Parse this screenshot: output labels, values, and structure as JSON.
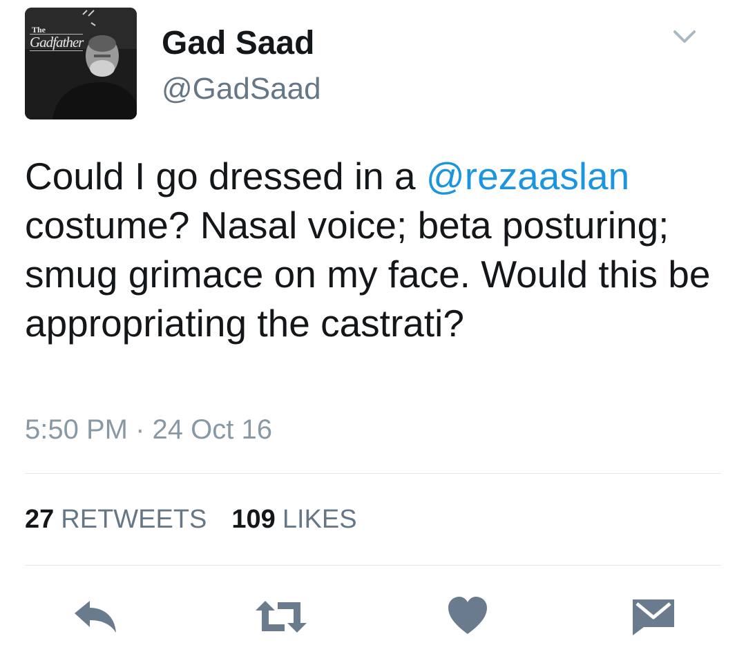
{
  "author": {
    "display_name": "Gad Saad",
    "handle": "@GadSaad",
    "avatar_title_small": "The",
    "avatar_title_main": "Gadfather"
  },
  "tweet": {
    "text_before_mention": "Could I go dressed in a ",
    "mention": "@rezaaslan",
    "text_after_mention": " costume? Nasal voice; beta posturing; smug grimace on my face. Would this be appropriating the castrati?",
    "time": "5:50 PM",
    "separator": "·",
    "date": "24 Oct 16"
  },
  "stats": {
    "retweets_count": "27",
    "retweets_label": "RETWEETS",
    "likes_count": "109",
    "likes_label": "LIKES"
  },
  "actions": {
    "icons": [
      "reply-icon",
      "retweet-icon",
      "like-icon",
      "direct-message-icon"
    ]
  },
  "colors": {
    "mention": "#1b95e0",
    "icon": "#697b8c",
    "muted_text": "#8899a6",
    "divider": "#e1e8ed"
  }
}
